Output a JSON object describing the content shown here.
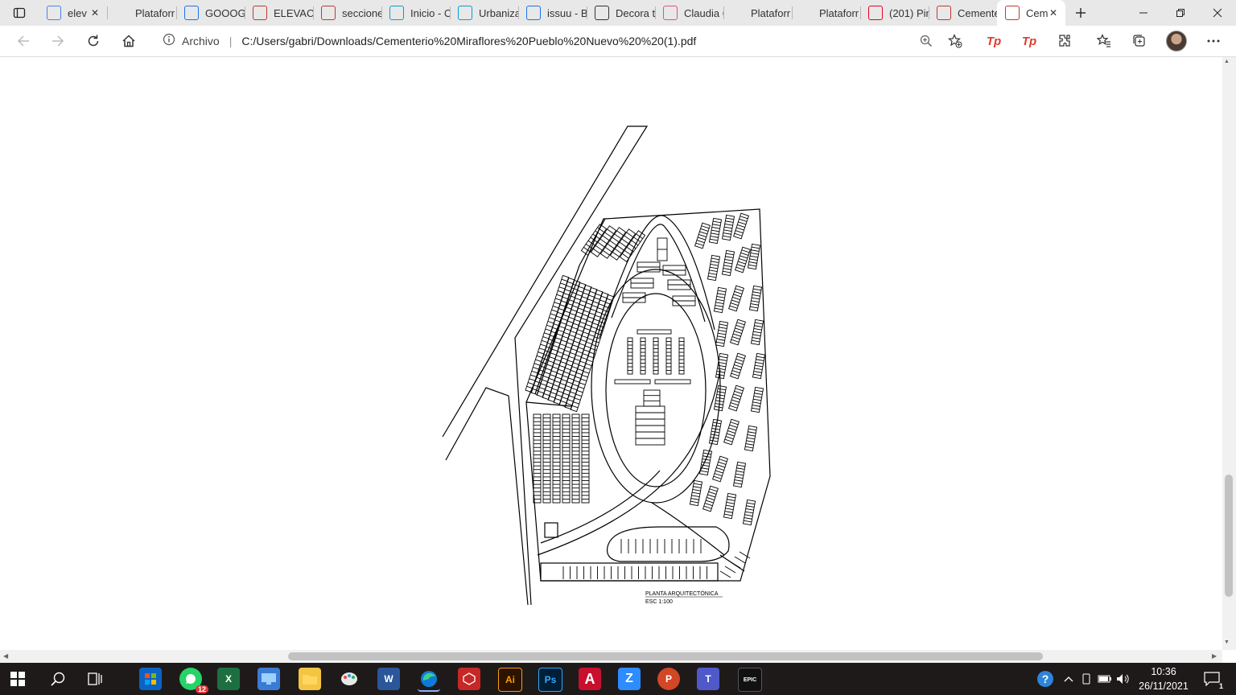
{
  "browser": {
    "tabs": [
      {
        "label": "elev",
        "icon": "google-icon",
        "color": "#4285f4"
      },
      {
        "label": "Plataforr",
        "icon": "blank-icon",
        "color": "#888888"
      },
      {
        "label": "GOOOGL",
        "icon": "bing-icon",
        "color": "#1a73e8"
      },
      {
        "label": "ELEVACIC",
        "icon": "pdf-icon",
        "color": "#c0392b"
      },
      {
        "label": "seccione",
        "icon": "pdf-icon",
        "color": "#c0392b"
      },
      {
        "label": "Inicio - C",
        "icon": "canva-icon",
        "color": "#00a0d6"
      },
      {
        "label": "Urbaniza",
        "icon": "canva-icon",
        "color": "#00a0d6"
      },
      {
        "label": "issuu - B",
        "icon": "bing-icon",
        "color": "#1a73e8"
      },
      {
        "label": "Decora tu",
        "icon": "houzz-icon",
        "color": "#333333"
      },
      {
        "label": "Claudia C",
        "icon": "dribbble-icon",
        "color": "#ea4c89"
      },
      {
        "label": "Plataforr",
        "icon": "blank-icon",
        "color": "#888888"
      },
      {
        "label": "Plataforr",
        "icon": "blank-icon",
        "color": "#888888"
      },
      {
        "label": "(201) Pin",
        "icon": "pinterest-icon",
        "color": "#e60023"
      },
      {
        "label": "Cemente",
        "icon": "pdf-icon",
        "color": "#c0392b"
      },
      {
        "label": "Cem",
        "icon": "pdf-icon",
        "color": "#c0392b"
      }
    ],
    "address_scheme_label": "Archivo",
    "url": "C:/Users/gabri/Downloads/Cementerio%20Miraflores%20Pueblo%20Nuevo%20%20(1).pdf"
  },
  "drawing": {
    "title": "PLANTA ARQUITECTÓNICA",
    "scale": "ESC 1:100"
  },
  "taskbar": {
    "whatsapp_badge": "12",
    "time": "10:36",
    "date": "26/11/2021",
    "notification_count": "1"
  }
}
